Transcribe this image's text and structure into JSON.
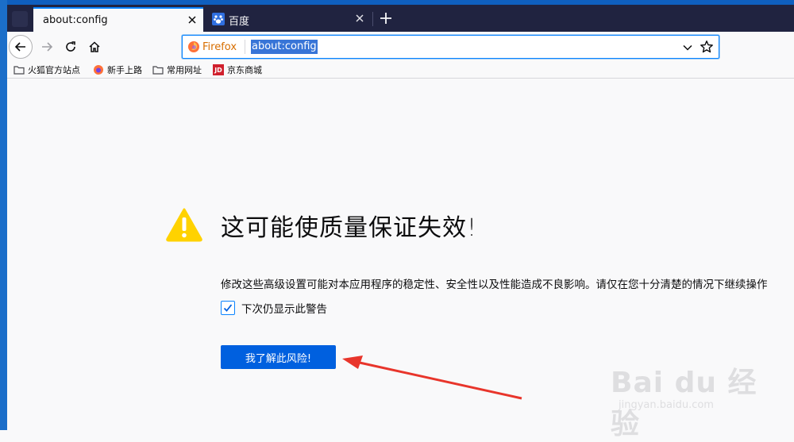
{
  "browser": {
    "tabs": [
      {
        "label": "about:config",
        "active": true
      },
      {
        "label": "百度",
        "active": false
      }
    ],
    "urlbar": {
      "identity_label": "Firefox",
      "url": "about:config"
    },
    "bookmarks": [
      {
        "label": "火狐官方站点",
        "icon": "folder-icon"
      },
      {
        "label": "新手上路",
        "icon": "firefox-icon"
      },
      {
        "label": "常用网址",
        "icon": "folder-icon"
      },
      {
        "label": "京东商城",
        "icon": "jd-icon",
        "icon_text": "JD"
      }
    ]
  },
  "page": {
    "title": "这可能使质量保证失效!",
    "description": "修改这些高级设置可能对本应用程序的稳定性、安全性以及性能造成不良影响。请仅在您十分清楚的情况下继续操作",
    "checkbox_label": "下次仍显示此警告",
    "checkbox_checked": true,
    "accept_button": "我了解此风险!"
  },
  "watermark": {
    "text": "Bai du 经验",
    "sub": "jingyan.baidu.com"
  },
  "colors": {
    "accent": "#0a84ff",
    "button": "#0060df",
    "tabbar": "#202340",
    "warning": "#ffd200",
    "arrow": "#e8352b"
  }
}
